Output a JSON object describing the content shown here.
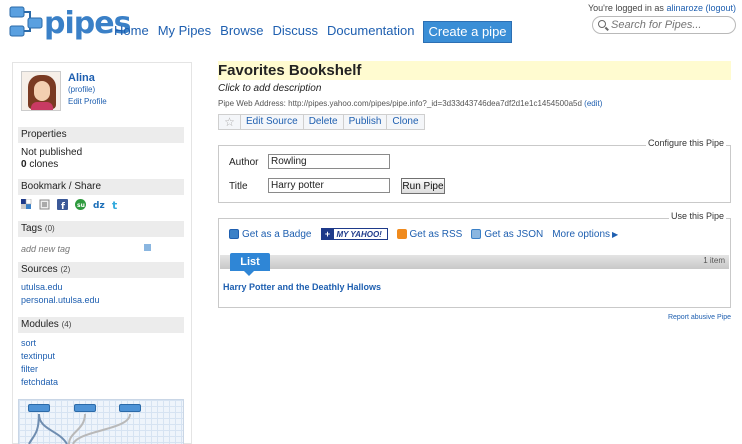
{
  "header": {
    "logo_text": "pipes",
    "nav": [
      "Home",
      "My Pipes",
      "Browse",
      "Discuss",
      "Documentation"
    ],
    "create_label": "Create a pipe",
    "login_prefix": "You're logged in as",
    "login_user": "alinaroze",
    "logout_label": "(logout)",
    "search_placeholder": "Search for Pipes..."
  },
  "sidebar": {
    "profile": {
      "name": "Alina",
      "profile_link": "(profile)",
      "edit_link": "Edit Profile"
    },
    "properties": {
      "heading": "Properties",
      "status": "Not published",
      "clones_count": "0",
      "clones_label": "clones"
    },
    "bookmark": {
      "heading": "Bookmark / Share",
      "icons": [
        "delicious-icon",
        "bookmark-icon",
        "facebook-icon",
        "stumbleupon-icon",
        "digg-icon",
        "twitter-icon"
      ]
    },
    "tags": {
      "heading": "Tags",
      "count": "(0)",
      "placeholder": "add new tag"
    },
    "sources": {
      "heading": "Sources",
      "count": "(2)",
      "items": [
        "utulsa.edu",
        "personal.utulsa.edu"
      ]
    },
    "modules": {
      "heading": "Modules",
      "count": "(4)",
      "items": [
        "sort",
        "textinput",
        "filter",
        "fetchdata"
      ]
    }
  },
  "main": {
    "title": "Favorites Bookshelf",
    "description": "Click to add description",
    "web_address_label": "Pipe Web Address:",
    "web_address": "http://pipes.yahoo.com/pipes/pipe.info?_id=3d33d43746dea7df2d1e1c1454500a5d",
    "edit_link": "(edit)",
    "toolbar": [
      "Edit Source",
      "Delete",
      "Publish",
      "Clone"
    ],
    "configure": {
      "legend": "Configure this Pipe",
      "author_label": "Author",
      "author_value": "Rowling",
      "title_label": "Title",
      "title_value": "Harry potter",
      "run_label": "Run Pipe"
    },
    "use": {
      "legend": "Use this Pipe",
      "badge": "Get as a Badge",
      "myyahoo": "MY YAHOO!",
      "rss": "Get as RSS",
      "json": "Get as JSON",
      "more": "More options",
      "list_tab": "List",
      "item_count": "1 item",
      "results": [
        "Harry Potter and the Deathly Hallows"
      ]
    },
    "report_link": "Report abusive Pipe"
  },
  "colors": {
    "link": "#1e5fb0",
    "accent": "#2f86d6",
    "title_bg": "#fffbd0"
  }
}
